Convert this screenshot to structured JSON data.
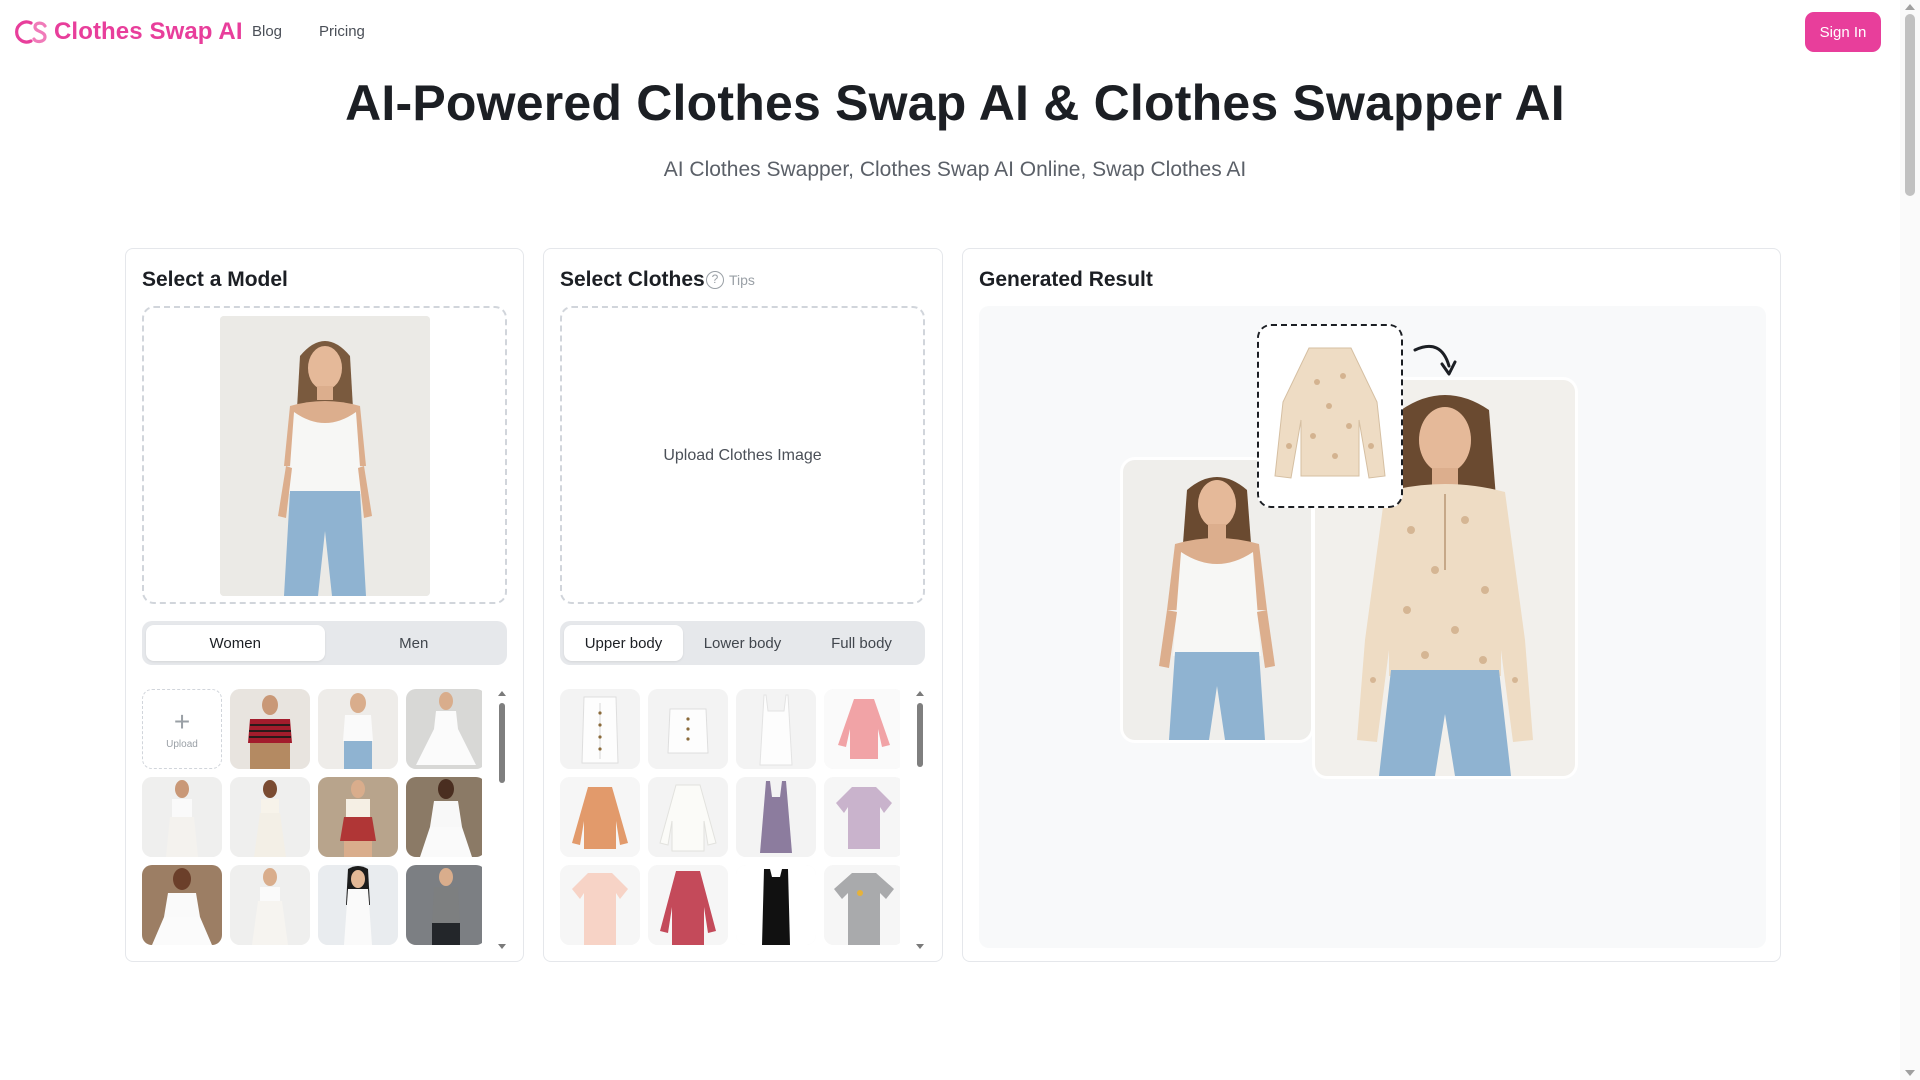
{
  "header": {
    "brand": "Clothes Swap AI",
    "nav": [
      "Blog",
      "Pricing"
    ],
    "sign_in": "Sign In"
  },
  "hero": {
    "title": "AI-Powered Clothes Swap AI & Clothes Swapper AI",
    "subtitle": "AI Clothes Swapper, Clothes Swap AI Online, Swap Clothes AI"
  },
  "model_panel": {
    "title": "Select a Model",
    "tabs": [
      "Women",
      "Men"
    ],
    "active_tab": "Women",
    "upload_label": "Upload"
  },
  "clothes_panel": {
    "title": "Select Clothes",
    "tips": "Tips",
    "upload_text": "Upload Clothes Image",
    "tabs": [
      "Upper body",
      "Lower body",
      "Full body"
    ],
    "active_tab": "Upper body"
  },
  "result_panel": {
    "title": "Generated Result"
  },
  "colors": {
    "brand": "#e83e9b",
    "panel_border": "#e5e7eb",
    "segment_bg": "#e6e8eb"
  }
}
